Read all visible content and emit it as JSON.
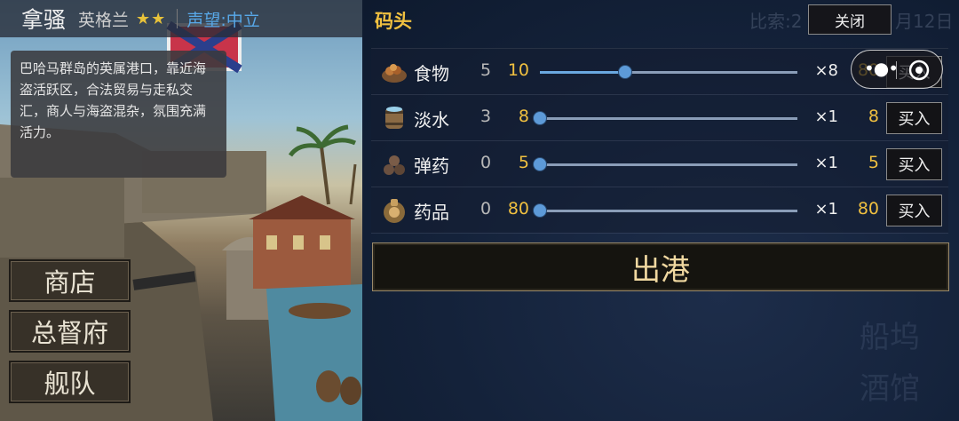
{
  "port": {
    "name": "拿骚",
    "nation": "英格兰",
    "stars": "★★",
    "reputation": "声望:中立",
    "description": "巴哈马群岛的英属港口，靠近海盗活跃区，合法贸易与走私交汇，商人与海盗混杂，氛围充满活力。"
  },
  "left_menu": {
    "shop": "商店",
    "governor": "总督府",
    "fleet": "舰队"
  },
  "background_ghost": {
    "info": "比索:2",
    "date": "月12日",
    "shipyard": "船坞",
    "tavern": "酒馆"
  },
  "dock": {
    "title": "码头",
    "close_label": "关闭",
    "depart_label": "出港",
    "items": [
      {
        "name": "食物",
        "have": "5",
        "qty": "10",
        "level": 0.33,
        "mult": "×8",
        "cost": "80",
        "buy": "买入",
        "icon": "food-icon"
      },
      {
        "name": "淡水",
        "have": "3",
        "qty": "8",
        "level": 0.0,
        "mult": "×1",
        "cost": "8",
        "buy": "买入",
        "icon": "water-barrel-icon"
      },
      {
        "name": "弹药",
        "have": "0",
        "qty": "5",
        "level": 0.0,
        "mult": "×1",
        "cost": "5",
        "buy": "买入",
        "icon": "cannonballs-icon"
      },
      {
        "name": "药品",
        "have": "0",
        "qty": "80",
        "level": 0.0,
        "mult": "×1",
        "cost": "80",
        "buy": "买入",
        "icon": "medicine-icon"
      }
    ]
  },
  "overlay": {
    "more_icon": "more-dots-icon",
    "target_icon": "target-icon"
  },
  "colors": {
    "accent_gold": "#f0c040",
    "reputation_blue": "#58a8e8",
    "slider_blue": "#5d9ad8"
  }
}
